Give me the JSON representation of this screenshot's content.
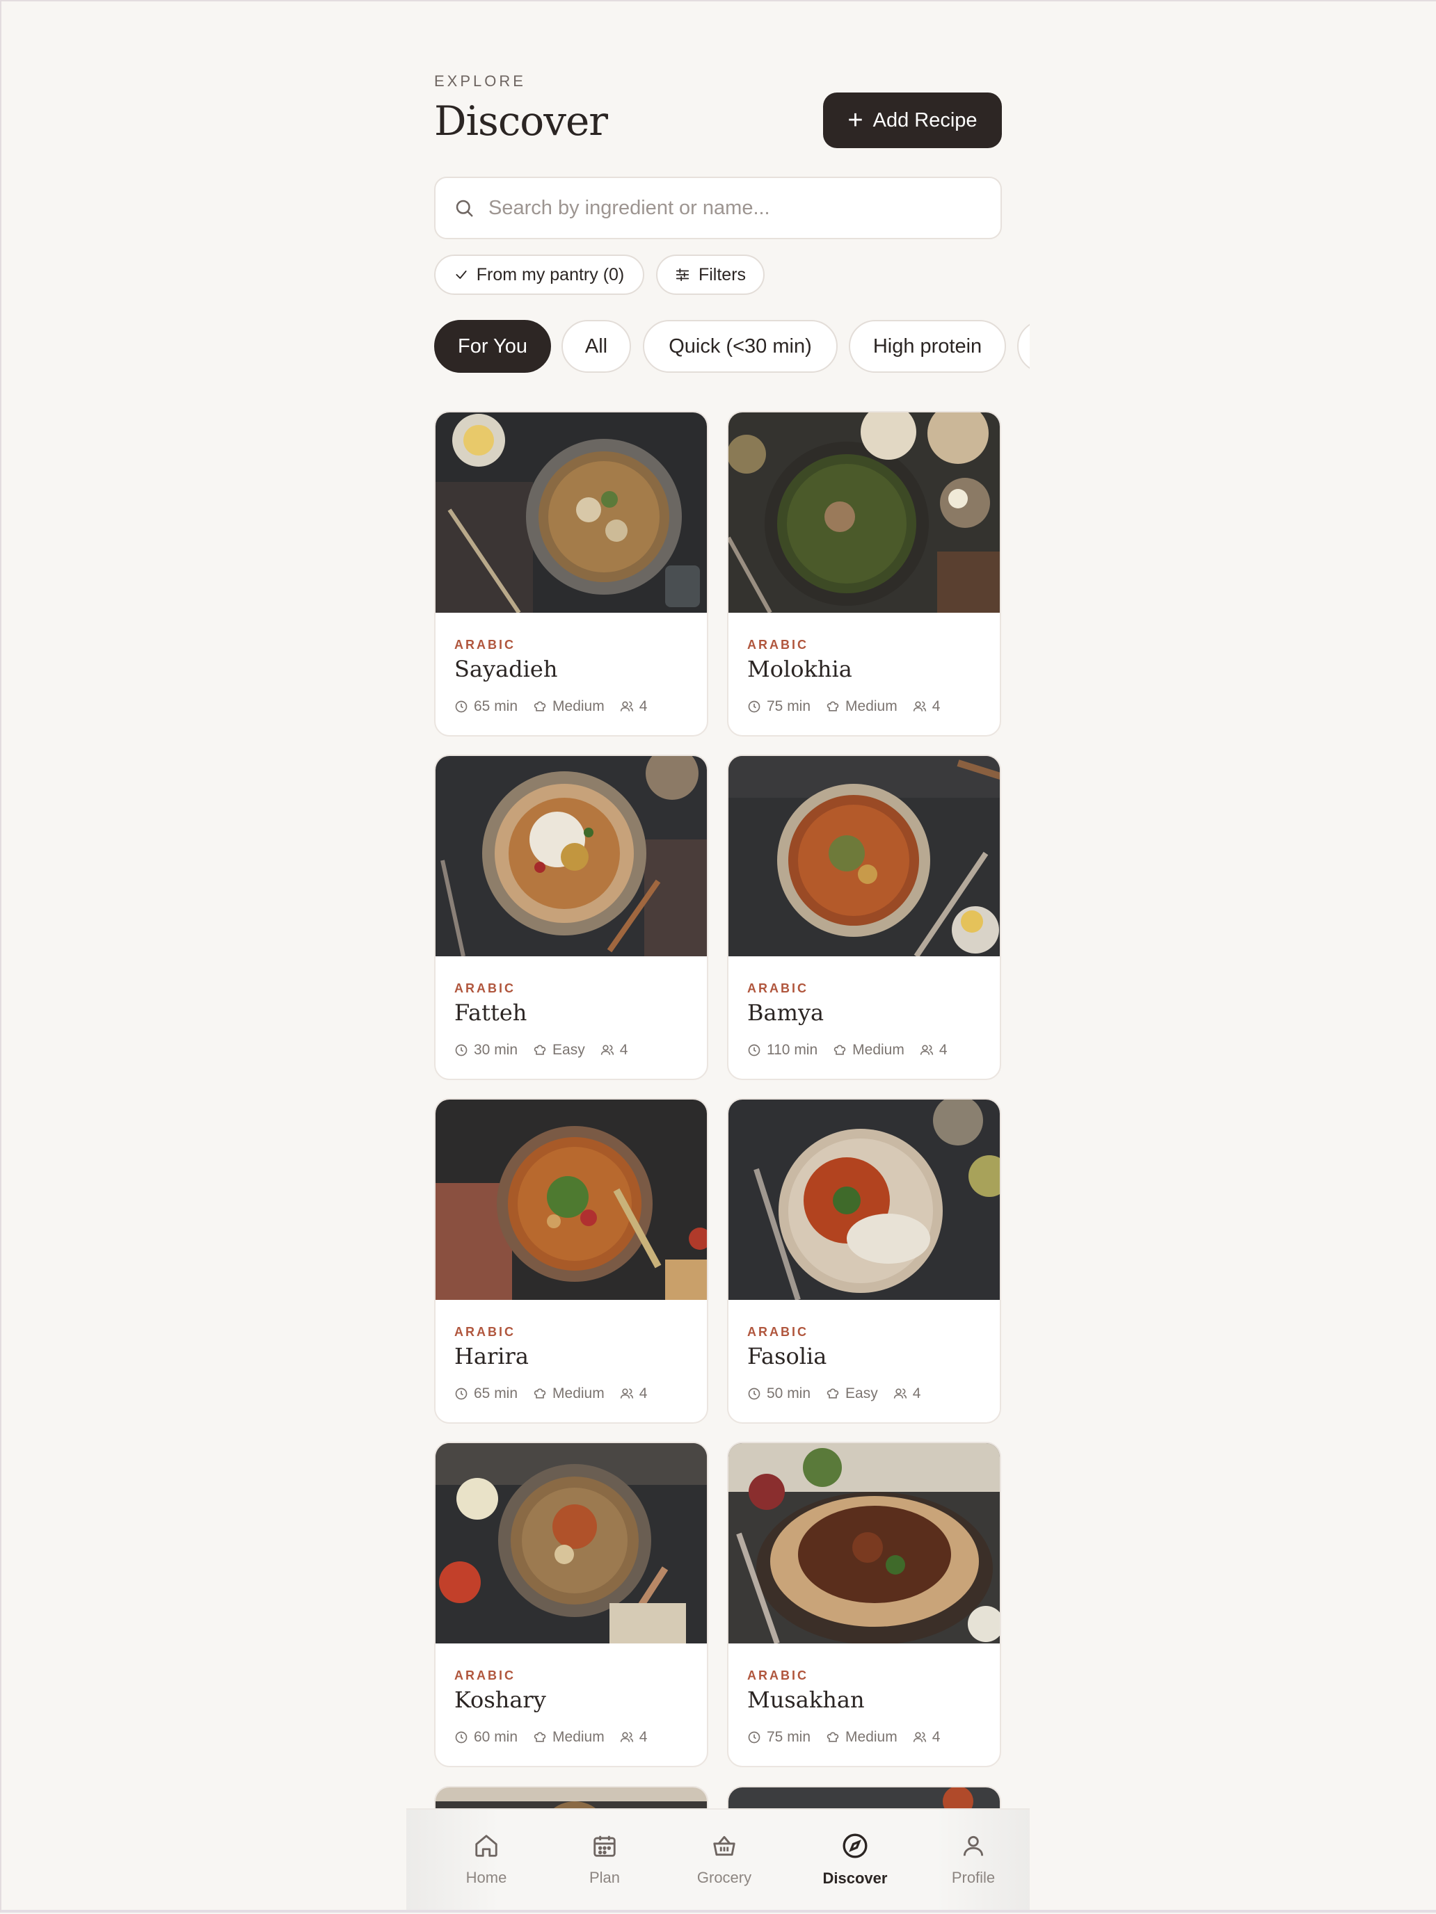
{
  "header": {
    "eyebrow": "EXPLORE",
    "title": "Discover",
    "add_label": "Add Recipe"
  },
  "search": {
    "placeholder": "Search by ingredient or name..."
  },
  "filters": {
    "pantry_label": "From my pantry (0)",
    "filters_label": "Filters"
  },
  "categories": [
    "For You",
    "All",
    "Quick (<30 min)",
    "High protein"
  ],
  "selected_category": "For You",
  "recipes": [
    {
      "cuisine": "ARABIC",
      "name": "Sayadieh",
      "time": "65 min",
      "difficulty": "Medium",
      "servings": "4"
    },
    {
      "cuisine": "ARABIC",
      "name": "Molokhia",
      "time": "75 min",
      "difficulty": "Medium",
      "servings": "4"
    },
    {
      "cuisine": "ARABIC",
      "name": "Fatteh",
      "time": "30 min",
      "difficulty": "Easy",
      "servings": "4"
    },
    {
      "cuisine": "ARABIC",
      "name": "Bamya",
      "time": "110 min",
      "difficulty": "Medium",
      "servings": "4"
    },
    {
      "cuisine": "ARABIC",
      "name": "Harira",
      "time": "65 min",
      "difficulty": "Medium",
      "servings": "4"
    },
    {
      "cuisine": "ARABIC",
      "name": "Fasolia",
      "time": "50 min",
      "difficulty": "Easy",
      "servings": "4"
    },
    {
      "cuisine": "ARABIC",
      "name": "Koshary",
      "time": "60 min",
      "difficulty": "Medium",
      "servings": "4"
    },
    {
      "cuisine": "ARABIC",
      "name": "Musakhan",
      "time": "75 min",
      "difficulty": "Medium",
      "servings": "4"
    }
  ],
  "nav": {
    "items": [
      "Home",
      "Plan",
      "Grocery",
      "Discover",
      "Profile"
    ],
    "active": "Discover"
  },
  "colors": {
    "accent_dark": "#2d2624",
    "cuisine_label": "#b0563d",
    "background": "#f8f6f3"
  }
}
